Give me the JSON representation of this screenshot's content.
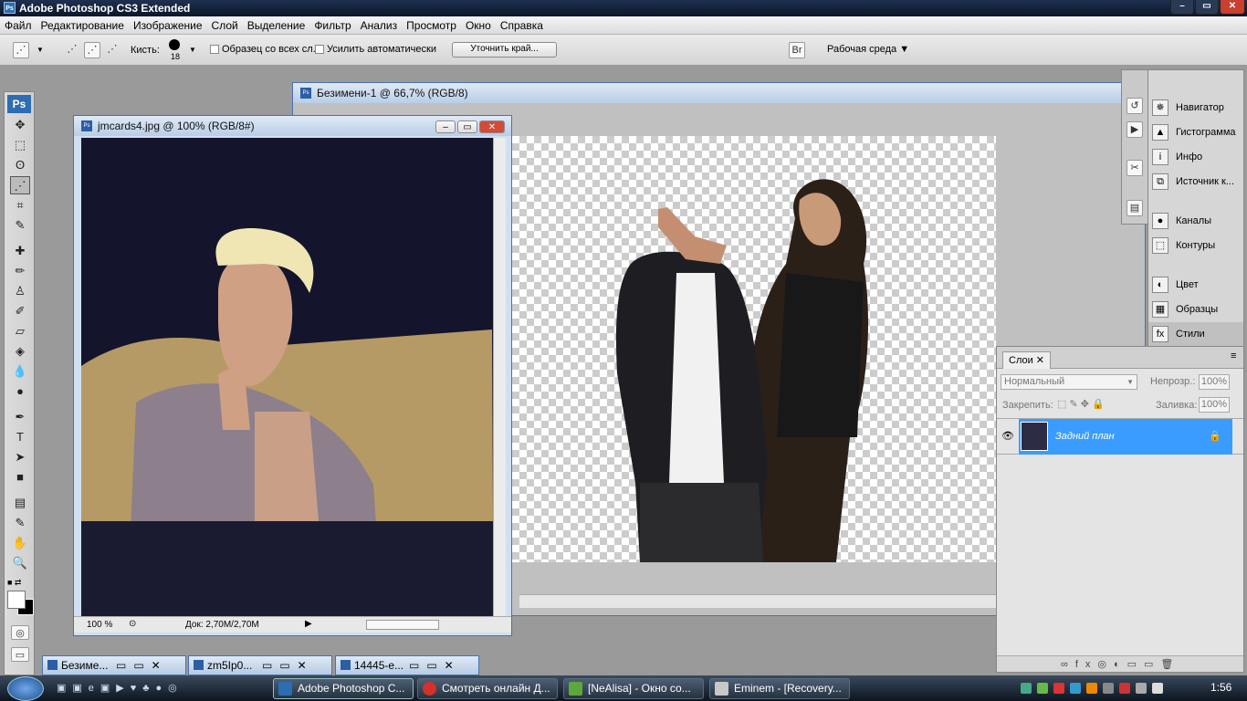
{
  "app": {
    "title": "Adobe Photoshop CS3 Extended"
  },
  "menu": [
    "Файл",
    "Редактирование",
    "Изображение",
    "Слой",
    "Выделение",
    "Фильтр",
    "Анализ",
    "Просмотр",
    "Окно",
    "Справка"
  ],
  "options": {
    "brush_label": "Кисть:",
    "brush_size": "18",
    "sample_all": "Образец со всех сл.",
    "auto_enhance": "Усилить автоматически",
    "refine_edge": "Уточнить край...",
    "workspace": "Рабочая среда"
  },
  "toolbox": {
    "ps": "Ps"
  },
  "doc_back": {
    "title": "Безимени-1 @ 66,7% (RGB/8)"
  },
  "doc_front": {
    "title": "jmcards4.jpg @ 100% (RGB/8#)",
    "zoom": "100 %",
    "docinfo": "Док: 2,70M/2,70M"
  },
  "panels": {
    "group1": [
      "Навигатор",
      "Гистограмма",
      "Инфо",
      "Источник к..."
    ],
    "group2": [
      "Каналы",
      "Контуры"
    ],
    "group3": [
      "Цвет",
      "Образцы",
      "Стили"
    ]
  },
  "layers": {
    "tab": "Слои",
    "blend": "Нормальный",
    "opacity_label": "Непрозр.:",
    "opacity": "100%",
    "lock_label": "Закрепить:",
    "fill_label": "Заливка:",
    "fill": "100%",
    "layer_name": "Задний план"
  },
  "minimized": [
    "Безиме...",
    "zm5Ip0...",
    "14445-e..."
  ],
  "taskbar": {
    "tasks": [
      "Adobe Photoshop C...",
      "Смотреть онлайн Д...",
      "[NeAlisa] - Окно со...",
      "Eminem - [Recovery..."
    ],
    "time": "1:56"
  },
  "colors": {
    "accent": "#3b9cff",
    "title_bg": "#1f3150"
  }
}
